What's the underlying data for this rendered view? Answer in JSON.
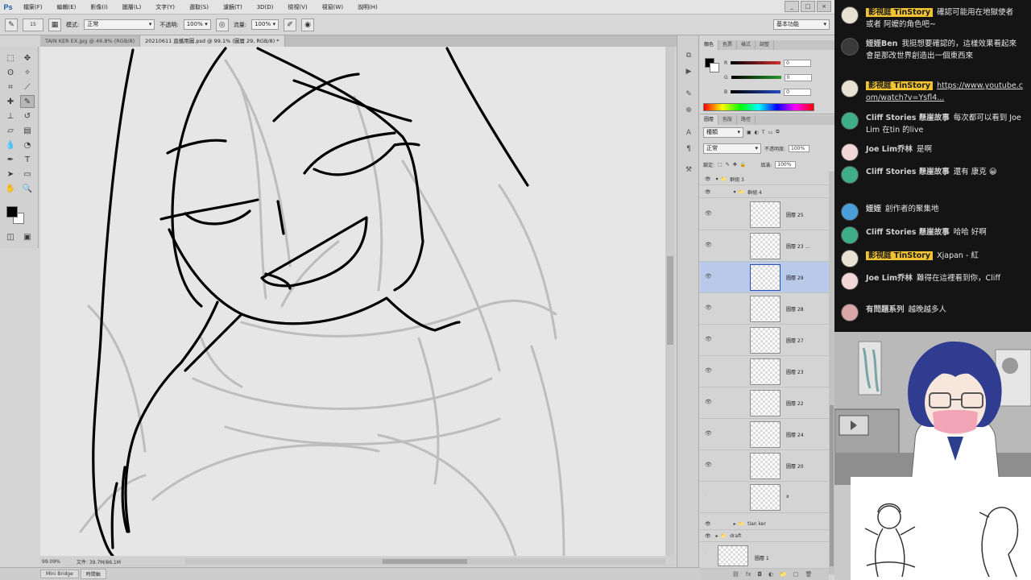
{
  "photoshop": {
    "logo": "Ps",
    "menu": [
      "檔案(F)",
      "編輯(E)",
      "影像(I)",
      "圖層(L)",
      "文字(Y)",
      "選取(S)",
      "濾鏡(T)",
      "3D(D)",
      "檢視(V)",
      "視窗(W)",
      "說明(H)"
    ],
    "window_buttons": [
      "_",
      "□",
      "×"
    ],
    "options": {
      "brush_size": "15",
      "mode_label": "模式:",
      "mode_value": "正常",
      "opacity_label": "不透明:",
      "opacity_value": "100%",
      "flow_label": "流量:",
      "flow_value": "100%",
      "workspace": "基本功能"
    },
    "doc_tabs": [
      {
        "label": "TAIN KER EX.jpg @ 46.8% (RGB/8)",
        "active": false
      },
      {
        "label": "20210611 直播用圖.psd @ 99.1% (圖層 29, RGB/8) *",
        "active": true
      }
    ],
    "status": {
      "zoom": "99.09%",
      "doc_size": "文件: 39.7M/86.1M"
    },
    "bottom_tabs": [
      "Mini Bridge",
      "時間軸"
    ],
    "color_panel": {
      "tabs": [
        "顏色",
        "色票",
        "樣式",
        "調整"
      ],
      "rows": [
        {
          "label": "R",
          "value": "0",
          "color": "#d23030"
        },
        {
          "label": "G",
          "value": "0",
          "color": "#2c9a2c"
        },
        {
          "label": "B",
          "value": "0",
          "color": "#2a4bc4"
        }
      ]
    },
    "layers_panel": {
      "tabs": [
        "圖層",
        "色版",
        "路徑"
      ],
      "kind_label": "種類",
      "blend_mode": "正常",
      "opacity_label": "不透明度:",
      "opacity_value": "100%",
      "lock_label": "鎖定:",
      "fill_label": "填滿:",
      "fill_value": "100%",
      "groups": [
        {
          "name": "群組 3"
        },
        {
          "name": "群組 4"
        }
      ],
      "layers": [
        {
          "name": "圖層 25",
          "selected": false
        },
        {
          "name": "圖層 23 ...",
          "selected": false
        },
        {
          "name": "圖層 29",
          "selected": true
        },
        {
          "name": "圖層 28",
          "selected": false
        },
        {
          "name": "圖層 27",
          "selected": false
        },
        {
          "name": "圖層 23",
          "selected": false
        },
        {
          "name": "圖層 22",
          "selected": false
        },
        {
          "name": "圖層 24",
          "selected": false
        },
        {
          "name": "圖層 20",
          "selected": false
        },
        {
          "name": "x",
          "selected": false
        }
      ],
      "bottom_groups": [
        {
          "name": "tian ker"
        },
        {
          "name": "draft"
        }
      ],
      "last_layer": "圖層 1"
    }
  },
  "chat": {
    "messages": [
      {
        "author": "影視庭 TinStory",
        "member": true,
        "text": "確認可能用在地獄使者 或者 阿嬤的角色吧~",
        "avatar_color": "#e9e2d2"
      },
      {
        "author": "姪姪Ben",
        "member": false,
        "text": "我挺想要確認的，這樣效果看起來會是那改世界創造出一個東西來",
        "avatar_color": "#3a3a3a"
      },
      {
        "author": "影視庭 TinStory",
        "member": true,
        "text": "https://www.youtube.com/watch?v=Ysfl4...",
        "link": true,
        "avatar_color": "#e9e2d2"
      },
      {
        "author": "Cliff Stories 懸崖故事",
        "member": false,
        "text": "每次都可以看到 Joe Lim 在tin 的live",
        "avatar_color": "#3fae86"
      },
      {
        "author": "Joe Lim乔林",
        "member": false,
        "text": "是啊",
        "avatar_color": "#f2d7d7"
      },
      {
        "author": "Cliff Stories 懸崖故事",
        "member": false,
        "text": "還有 康克 😀",
        "avatar_color": "#3fae86"
      },
      {
        "author": "姪姪",
        "member": false,
        "text": "創作者的聚集地",
        "avatar_color": "#4a9fd8"
      },
      {
        "author": "Cliff Stories 懸崖故事",
        "member": false,
        "text": "哈哈 好啊",
        "avatar_color": "#3fae86"
      },
      {
        "author": "影視庭 TinStory",
        "member": true,
        "text": "Xjapan - 紅",
        "avatar_color": "#e9e2d2"
      },
      {
        "author": "Joe Lim乔林",
        "member": false,
        "text": "難得在這裡看到你，Cliff",
        "avatar_color": "#f2d7d7"
      },
      {
        "author": "有問題系列",
        "member": false,
        "text": "越晚越多人",
        "avatar_color": "#d9a7a7"
      }
    ]
  },
  "colors": {
    "member_badge": "#f1c232",
    "chat_bg": "#141414",
    "layer_selected": "#b9c9ea"
  }
}
